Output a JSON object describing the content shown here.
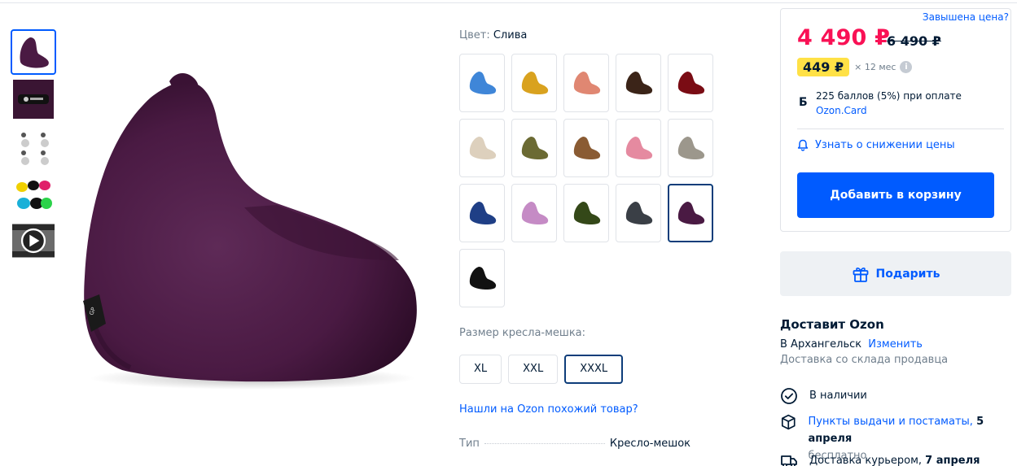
{
  "variants": {
    "color_label": "Цвет:",
    "color_value": "Слива",
    "swatches": [
      {
        "color": "#3f86d8",
        "name": "blue"
      },
      {
        "color": "#d9a21f",
        "name": "mustard"
      },
      {
        "color": "#e08772",
        "name": "coral"
      },
      {
        "color": "#3b2418",
        "name": "brown-dark"
      },
      {
        "color": "#7a0c14",
        "name": "burgundy"
      },
      {
        "color": "#ddd0bd",
        "name": "beige"
      },
      {
        "color": "#6b6a33",
        "name": "olive"
      },
      {
        "color": "#8a5b33",
        "name": "brown"
      },
      {
        "color": "#e58aa0",
        "name": "pink"
      },
      {
        "color": "#9c978c",
        "name": "grey"
      },
      {
        "color": "#1f3f86",
        "name": "navy"
      },
      {
        "color": "#c58bc5",
        "name": "lilac"
      },
      {
        "color": "#344818",
        "name": "dark-green"
      },
      {
        "color": "#3a3f46",
        "name": "graphite"
      },
      {
        "color": "#4a1a43",
        "name": "plum"
      },
      {
        "color": "#111111",
        "name": "black"
      }
    ],
    "size_label": "Размер кресла-мешка:",
    "sizes": [
      "XL",
      "XXL",
      "XXXL"
    ],
    "similar_link": "Нашли на Ozon похожий товар?",
    "spec_key": "Тип",
    "spec_value": "Кресло-мешок"
  },
  "price": {
    "complain": "Завышена цена?",
    "current": "4 490 ₽",
    "old": "6 490 ₽",
    "installment": "449 ₽",
    "installment_term": "× 12 мес",
    "bonus_text": "225 баллов (5%) при оплате",
    "bonus_card": "Ozon.Card",
    "bonus_icon_letter": "Б",
    "notify": "Узнать о снижении цены",
    "add_to_cart": "Добавить в корзину",
    "gift": "Подарить"
  },
  "delivery": {
    "title": "Доставит Ozon",
    "city": "В Архангельск",
    "change": "Изменить",
    "source": "Доставка со склада продавца",
    "in_stock": "В наличии",
    "pickup_link": "Пункты выдачи и постаматы,",
    "pickup_date": "5 апреля",
    "pickup_price": "бесплатно",
    "courier": "Доставка курьером,",
    "courier_date": "7 апреля"
  },
  "colors": {
    "accent": "#005bff",
    "price": "#f91155",
    "badge": "#ffe146",
    "product": "#4a1a43"
  }
}
